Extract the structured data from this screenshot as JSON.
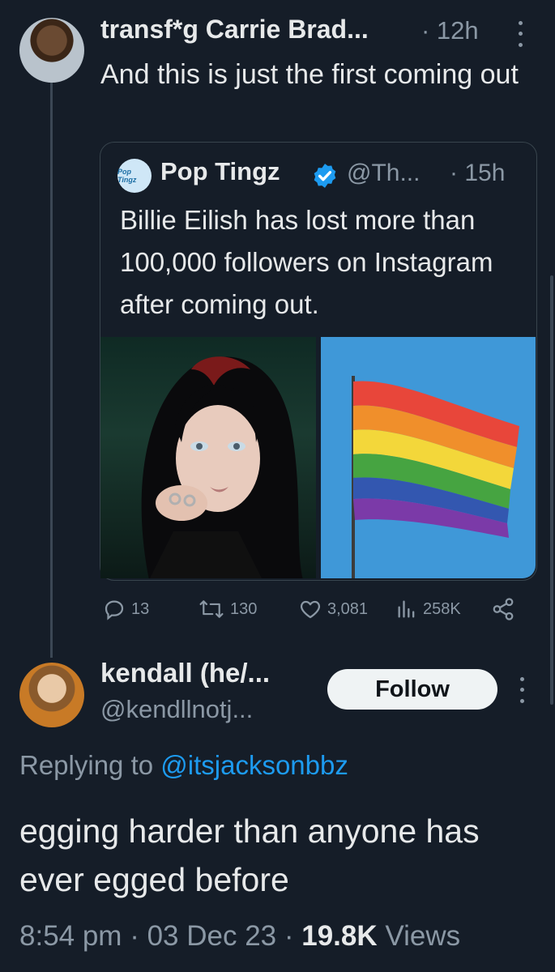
{
  "tweet1": {
    "display_name": "transf*g Carrie Brad...",
    "time": "· 12h",
    "text": "And this is just the first coming out",
    "avatar_icon": "user-avatar"
  },
  "quote": {
    "avatar_label": "Pop Tingz",
    "display_name": "Pop Tingz",
    "handle": "@Th...",
    "time": "· 15h",
    "text": "Billie Eilish has lost more than 100,000 followers on Instagram after coming out.",
    "verified_icon": "verified-badge-icon",
    "images": [
      "portrait-photo",
      "rainbow-flag-photo"
    ]
  },
  "actions": {
    "replies": "13",
    "retweets": "130",
    "likes": "3,081",
    "views": "258K"
  },
  "tweet2": {
    "display_name": "kendall (he/...",
    "handle": "@kendllnotj...",
    "follow_label": "Follow",
    "replying_prefix": "Replying to ",
    "replying_mention": "@itsjacksonbbz",
    "text": "egging harder than anyone has ever egged before",
    "time": "8:54 pm",
    "date": "03 Dec 23",
    "views_count": "19.8K",
    "views_label": "Views"
  },
  "colors": {
    "background": "#151d28",
    "text": "#e7e9ea",
    "muted": "#8b98a5",
    "accent": "#1d9bf0"
  }
}
